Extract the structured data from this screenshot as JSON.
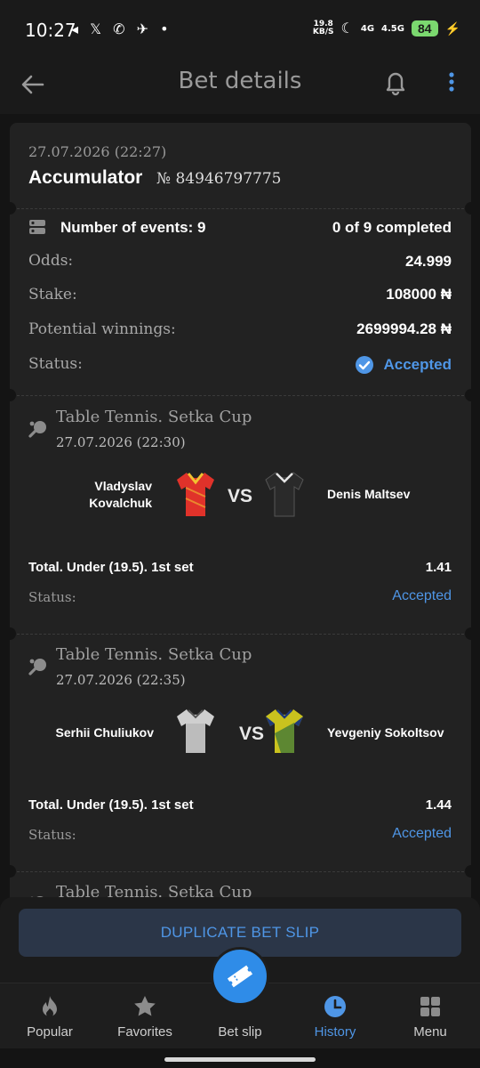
{
  "status_bar": {
    "time": "10:27",
    "left_icons": "◂ 𝕏 ✆ ✈ •",
    "kbs_top": "19.8",
    "kbs_bottom": "KB/S",
    "net1": "4G",
    "net2": "4.5G",
    "battery": "84"
  },
  "header": {
    "title": "Bet details"
  },
  "bet": {
    "date": "27.07.2026 (22:27)",
    "type": "Accumulator",
    "number": "№ 84946797775",
    "events_label": "Number of events: 9",
    "events_completed": "0 of 9 completed",
    "odds_label": "Odds:",
    "odds_value": "24.999",
    "stake_label": "Stake:",
    "stake_value": "108000 ₦",
    "winnings_label": "Potential winnings:",
    "winnings_value": "2699994.28 ₦",
    "status_label": "Status:",
    "status_value": "Accepted"
  },
  "events": [
    {
      "league": "Table Tennis. Setka Cup",
      "date": "27.07.2026 (22:30)",
      "player1_line1": "Vladyslav",
      "player1_line2": "Kovalchuk",
      "player2": "Denis Maltsev",
      "vs": "VS",
      "market": "Total. Under (19.5). 1st set",
      "odd": "1.41",
      "status_label": "Status:",
      "status_value": "Accepted"
    },
    {
      "league": "Table Tennis. Setka Cup",
      "date": "27.07.2026 (22:35)",
      "player1": "Serhii Chuliukov",
      "player2": "Yevgeniy Sokoltsov",
      "vs": "VS",
      "market": "Total. Under (19.5). 1st set",
      "odd": "1.44",
      "status_label": "Status:",
      "status_value": "Accepted"
    },
    {
      "league": "Table Tennis. Setka Cup"
    }
  ],
  "actions": {
    "duplicate": "DUPLICATE BET SLIP"
  },
  "nav": [
    {
      "label": "Popular",
      "icon": "flame-icon"
    },
    {
      "label": "Favorites",
      "icon": "star-icon"
    },
    {
      "label": "Bet slip",
      "icon": "ticket-icon"
    },
    {
      "label": "History",
      "icon": "clock-icon"
    },
    {
      "label": "Menu",
      "icon": "grid-icon"
    }
  ],
  "colors": {
    "accent": "#4f96e6",
    "background": "#141414",
    "card": "#222222",
    "fab": "#2f8ce8"
  }
}
